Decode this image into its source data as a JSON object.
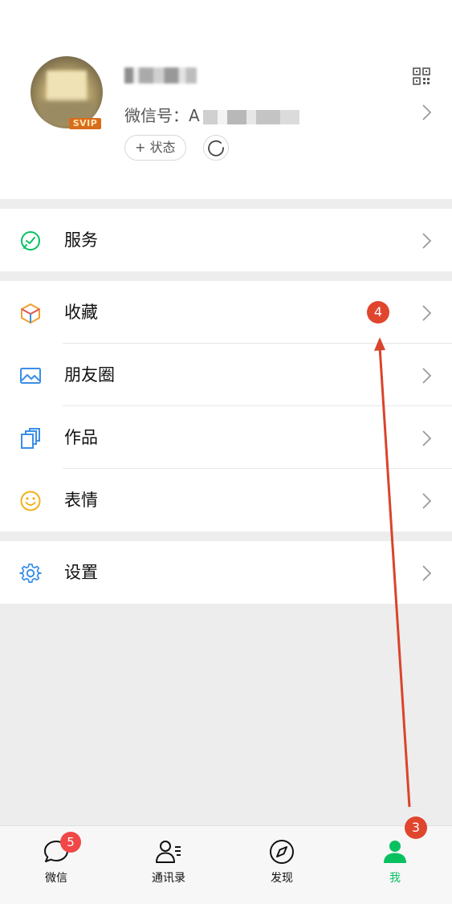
{
  "profile": {
    "svip_label": "SVIP",
    "wechat_id_label": "微信号：A",
    "status_button_label": "+ 状态"
  },
  "menu": {
    "service": "服务",
    "favorites": "收藏",
    "favorites_badge": "4",
    "moments": "朋友圈",
    "works": "作品",
    "stickers": "表情",
    "settings": "设置"
  },
  "tabbar": {
    "chats": "微信",
    "chats_badge": "5",
    "contacts": "通讯录",
    "discover": "发现",
    "me": "我"
  },
  "annotation": {
    "step_badge": "3"
  },
  "colors": {
    "accent_green": "#07c160",
    "badge_red": "#f04747",
    "annotation_red": "#e0452d"
  }
}
